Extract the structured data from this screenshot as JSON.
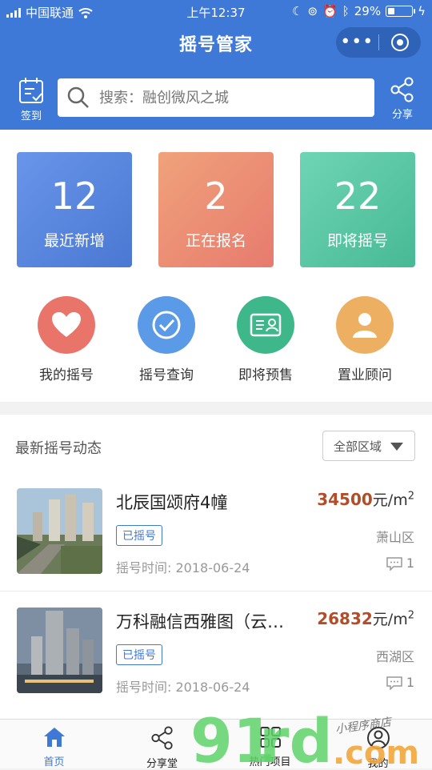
{
  "status_bar": {
    "carrier": "中国联通",
    "time": "上午12:37",
    "battery": "29%",
    "battery_level": 0.29
  },
  "nav": {
    "title": "摇号管家",
    "more_icon": "more-icon",
    "close_icon": "target-icon"
  },
  "search": {
    "signin_label": "签到",
    "placeholder": "搜索：融创微风之城",
    "share_label": "分享"
  },
  "stats": [
    {
      "num": "12",
      "label": "最近新增"
    },
    {
      "num": "2",
      "label": "正在报名"
    },
    {
      "num": "22",
      "label": "即将摇号"
    }
  ],
  "quick_links": [
    {
      "label": "我的摇号",
      "icon": "heart-icon",
      "color": "#e9746a"
    },
    {
      "label": "摇号查询",
      "icon": "check-icon",
      "color": "#5b9ae6"
    },
    {
      "label": "即将预售",
      "icon": "id-card-icon",
      "color": "#3eb88a"
    },
    {
      "label": "置业顾问",
      "icon": "person-icon",
      "color": "#edb062"
    }
  ],
  "list": {
    "title": "最新摇号动态",
    "region_filter": "全部区域",
    "items": [
      {
        "name": "北辰国颂府4幢",
        "price": "34500",
        "unit": "元/m",
        "sup": "2",
        "tag": "已摇号",
        "area": "萧山区",
        "time": "摇号时间: 2018-06-24",
        "comments": "1"
      },
      {
        "name": "万科融信西雅图（云…",
        "price": "26832",
        "unit": "元/m",
        "sup": "2",
        "tag": "已摇号",
        "area": "西湖区",
        "time": "摇号时间: 2018-06-24",
        "comments": "1"
      }
    ]
  },
  "tabbar": [
    {
      "label": "首页",
      "icon": "home-icon"
    },
    {
      "label": "分享堂",
      "icon": "share-icon"
    },
    {
      "label": "热门项目",
      "icon": "grid-icon"
    },
    {
      "label": "我的",
      "icon": "user-icon"
    }
  ],
  "watermark": {
    "text1": "91",
    "text2": "rd",
    "text3": ".com",
    "handwriting": "小程序商店"
  },
  "colors": {
    "primary": "#3f79d7",
    "price": "#b24d2a"
  }
}
